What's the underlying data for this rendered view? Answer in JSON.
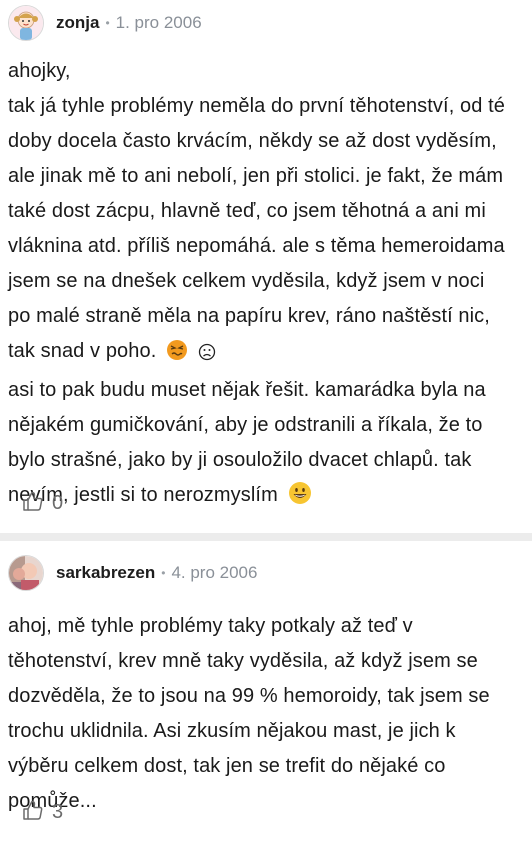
{
  "posts": [
    {
      "username": "zonja",
      "separator": "•",
      "date": "1. pro 2006",
      "avatar_icon": "girl-avatar-icon",
      "lines": [
        "ahojky,",
        "tak já tyhle problémy neměla do první těhotenství, od té",
        "doby docela často krvácím, někdy se až dost vyděsím,",
        "ale jinak mě to ani nebolí, jen při stolici. je fakt, že mám",
        "také dost zácpu, hlavně teď, co jsem těhotná a ani mi",
        "vláknina atd. příliš nepomáhá. ale s těma hemeroidama",
        "jsem se na dnešek celkem vyděsila, když jsem v noci",
        "po malé straně měla na papíru krev, ráno naštěstí nic,",
        "tak snad v poho.",
        "asi to pak budu muset nějak řešit. kamarádka byla na",
        "nějakém gumičkování, aby je odstranili a říkala, že to",
        "bylo strašné, jako by ji osouložilo dvacet chlapů. tak",
        "nevím, jestli si to nerozmyslím"
      ],
      "likes": "0"
    },
    {
      "username": "sarkabrezen",
      "separator": "•",
      "date": "4. pro 2006",
      "avatar_icon": "baby-photo-avatar-icon",
      "lines": [
        "ahoj, mě tyhle problémy taky potkaly až teď v",
        "těhotenství, krev mně taky vyděsila, až když jsem se",
        "dozvěděla, že to jsou na 99 % hemoroidy, tak jsem se",
        "trochu uklidnila. Asi zkusím nějakou mast, je jich k",
        "výběru celkem dost, tak jen se trefit do nějaké co",
        "pomůže..."
      ],
      "likes": "3"
    }
  ],
  "colors": {
    "emoji_yellow": "#f7c531",
    "emoji_orange": "#f29a1f",
    "muted": "#8a9098",
    "divider": "#ececec"
  }
}
